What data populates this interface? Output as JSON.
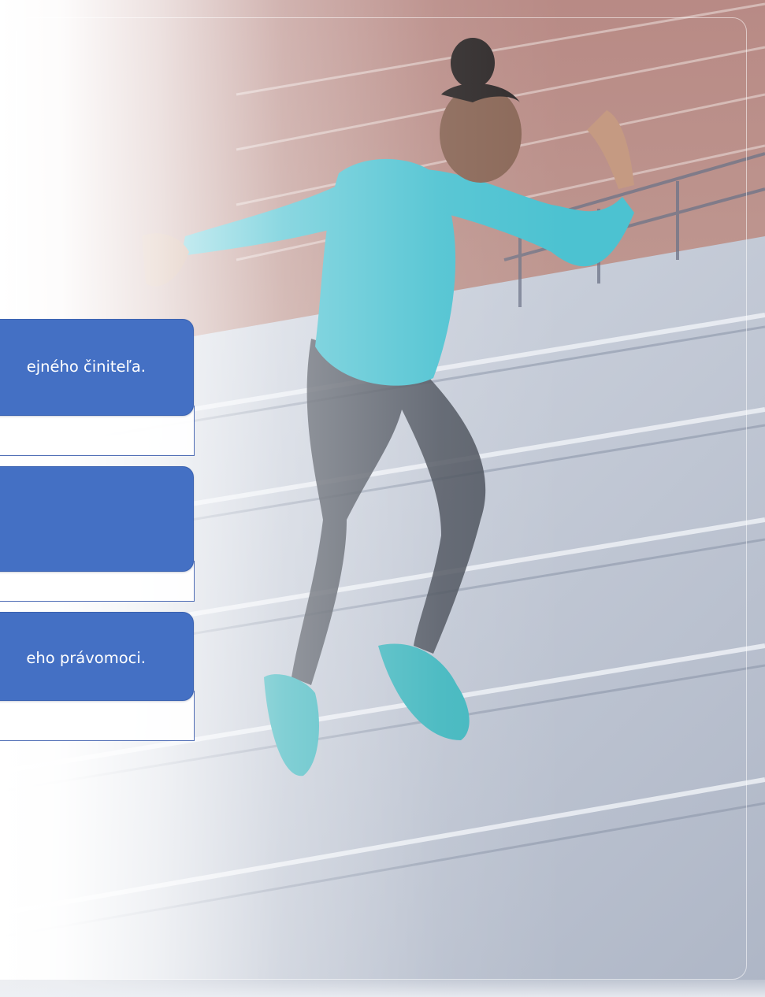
{
  "cards": [
    {
      "text": "ejného činiteľa."
    },
    {
      "text": ""
    },
    {
      "text": "eho právomoci."
    }
  ],
  "colors": {
    "card_blue": "#4470c4",
    "card_border": "#4f6db5"
  },
  "background": {
    "image": "athlete-running-up-stadium-stairs"
  }
}
